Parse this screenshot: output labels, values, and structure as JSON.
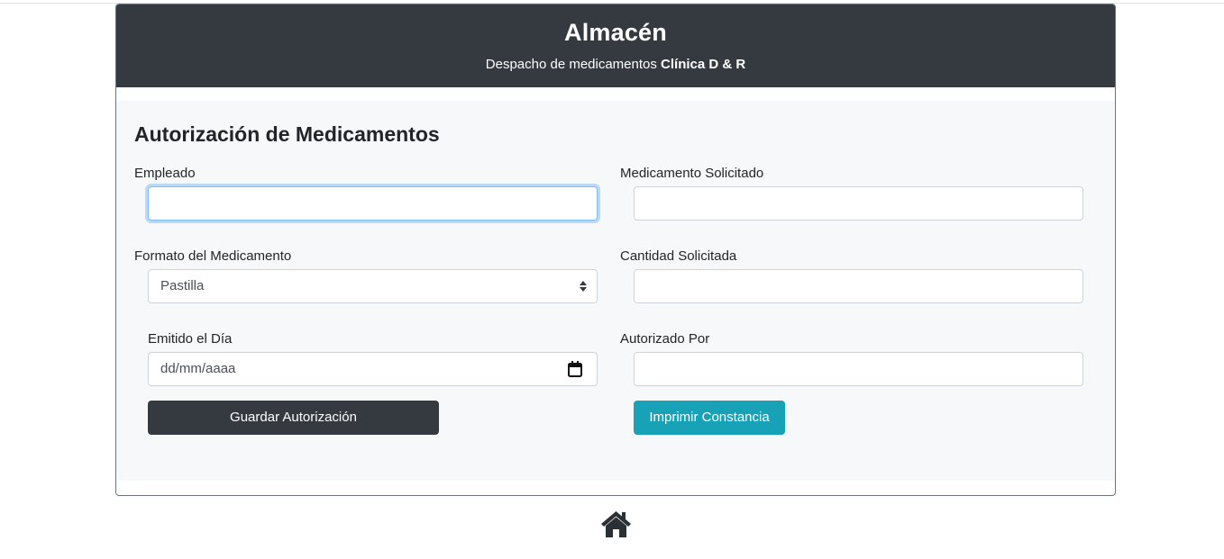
{
  "header": {
    "title": "Almacén",
    "subtitle_prefix": "Despacho de medicamentos ",
    "subtitle_bold": "Clínica D & R"
  },
  "form": {
    "title": "Autorización de Medicamentos",
    "empleado": {
      "label": "Empleado",
      "value": ""
    },
    "medicamento": {
      "label": "Medicamento Solicitado",
      "value": ""
    },
    "formato": {
      "label": "Formato del Medicamento",
      "selected": "Pastilla"
    },
    "cantidad": {
      "label": "Cantidad Solicitada",
      "value": ""
    },
    "emitido": {
      "label": "Emitido el Día",
      "placeholder": "dd/mm/aaaa"
    },
    "autorizado": {
      "label": "Autorizado Por",
      "value": ""
    },
    "save_label": "Guardar Autorización",
    "print_label": "Imprimir Constancia"
  },
  "footer": {
    "home_icon": "home-icon"
  },
  "colors": {
    "dark": "#343a40",
    "info": "#17a2b8",
    "body_bg": "#f7f8f9",
    "focus": "#80bdff"
  }
}
